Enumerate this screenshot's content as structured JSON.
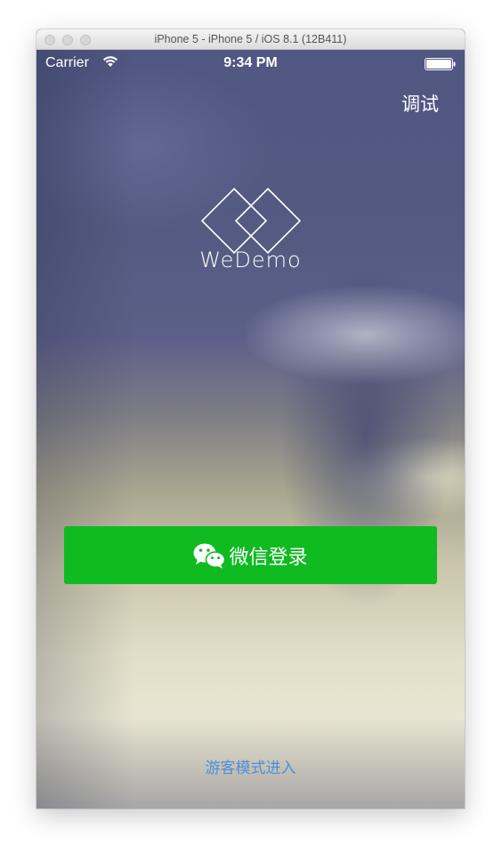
{
  "window": {
    "title": "iPhone 5 - iPhone 5 / iOS 8.1 (12B411)"
  },
  "status_bar": {
    "carrier": "Carrier",
    "time": "9:34 PM",
    "wifi_icon": "wifi-icon",
    "battery_icon": "battery-icon"
  },
  "header": {
    "debug_label": "调试"
  },
  "branding": {
    "logo_icon": "wedemo-logo-icon",
    "app_name": "WeDemo"
  },
  "actions": {
    "wechat_login_label": "微信登录",
    "wechat_icon": "wechat-icon",
    "guest_mode_label": "游客模式进入"
  },
  "colors": {
    "login_button": "#0fbb21",
    "guest_link": "#4e8fd6"
  }
}
